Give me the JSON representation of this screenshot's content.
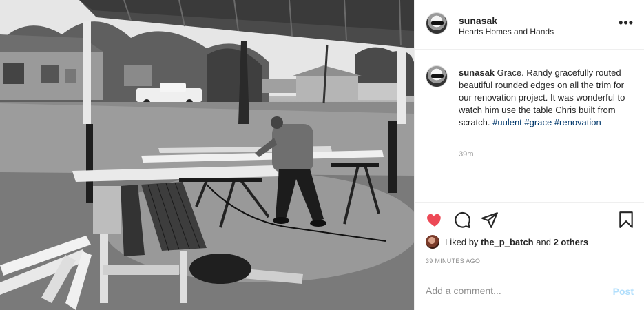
{
  "post": {
    "photo_description_icon": "photo",
    "username": "sunasak",
    "location": "Hearts Homes and Hands",
    "more_label": "•••"
  },
  "caption": {
    "username": "sunasak",
    "text": "Grace. Randy gracefully routed beautiful rounded edges on all the trim for our renovation project. It was wonderful to watch him use the table Chris built from scratch.",
    "hashtags": [
      "#uulent",
      "#grace",
      "#renovation"
    ],
    "time": "39m"
  },
  "actions": {
    "like_icon": "heart-icon",
    "comment_icon": "comment-icon",
    "share_icon": "share-icon",
    "save_icon": "bookmark-icon",
    "like_color": "#ed4956"
  },
  "likes": {
    "prefix": "Liked by",
    "user": "the_p_batch",
    "joiner": "and",
    "others": "2 others"
  },
  "timestamp": "39 MINUTES AGO",
  "comment": {
    "placeholder": "Add a comment...",
    "post_label": "Post",
    "post_color": "#b2dffc"
  }
}
